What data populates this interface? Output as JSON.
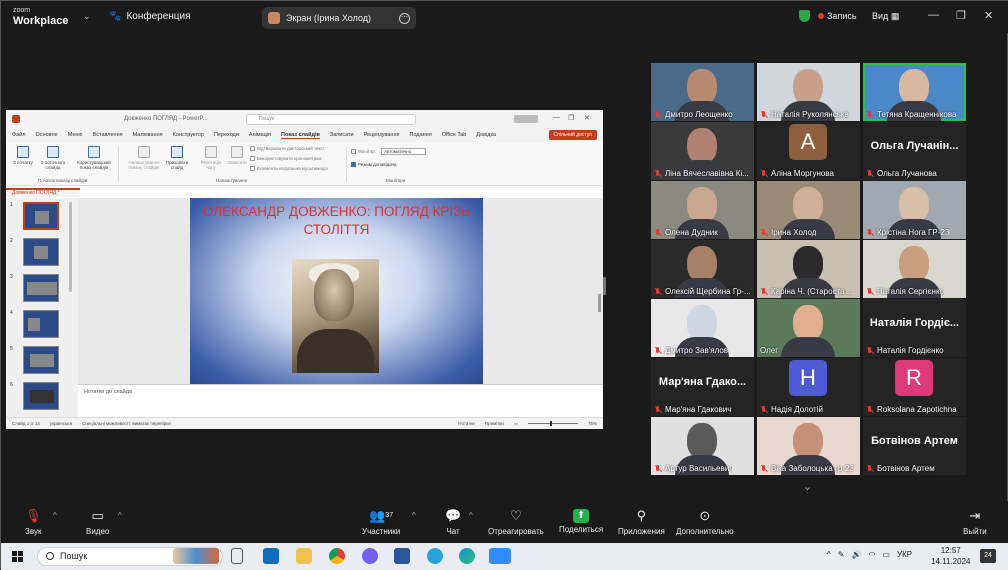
{
  "titlebar": {
    "app_top": "zoom",
    "app_bottom": "Workplace",
    "conference": "Конференция",
    "screen_label": "Экран (Ірина Холод)",
    "recording": "Запись",
    "view": "Вид"
  },
  "powerpoint": {
    "doc_title": "Довженко ПОГЛЯД - PowerP...",
    "search_placeholder": "Пошук",
    "tabs": [
      "Файл",
      "Основне",
      "Меню",
      "Вставлення",
      "Малювання",
      "Конструктор",
      "Переходи",
      "Анімація",
      "Показ слайдів",
      "Записати",
      "Рецензування",
      "Подання",
      "Office Tab",
      "Довідка"
    ],
    "share_button": "Спільний доступ",
    "ribbon": {
      "from_start": "З початку",
      "from_current": "З поточного слайда",
      "custom_show": "Користувацький показ слайдів",
      "setup_show": "Налаштування показу слайдів",
      "hide_slide": "Приховати слайд",
      "rehearse": "Репетиція часу",
      "record": "Записати",
      "chk_narration": "Відтворювати дикторський текст",
      "chk_timings": "Використовувати хронометраж",
      "chk_controls": "Елементи керування мультимедіа",
      "monitor_label": "Монітор:",
      "monitor_value": "Автоматично",
      "presenter_view": "Режим доповідача",
      "group_start": "Початок показу слайдів",
      "group_setup": "Налаштування",
      "group_monitors": "Монітори"
    },
    "file_tab": "Довженко ПОГЛЯД *",
    "slide_numbers": [
      "1",
      "2",
      "3",
      "4",
      "5",
      "6"
    ],
    "slide_title": "ОЛЕКСАНДР ДОВЖЕНКО: ПОГЛЯД КРІЗЬ СТОЛІТТЯ",
    "notes": "Нотатки до слайда",
    "status": {
      "slide_count": "Слайд 1 із 14",
      "language": "українська",
      "accessibility": "Спеціальні можливості: вимагає перевірки",
      "notes_btn": "Нотатки",
      "comments_btn": "Примітки",
      "zoom": "75%"
    }
  },
  "participants": [
    {
      "name": "Дмитро Леощенко",
      "kind": "video"
    },
    {
      "name": "Наталія Руколянська",
      "kind": "video"
    },
    {
      "name": "Тетяна Кращеннікова",
      "kind": "video",
      "active": true
    },
    {
      "name": "Ліна Вячеславівна Кі...",
      "kind": "video"
    },
    {
      "name": "Аліна Моргунова",
      "kind": "letter",
      "letter": "А",
      "color": "#8c5e3c"
    },
    {
      "name": "Ольга Лучанова",
      "kind": "text",
      "big": "Ольга Лучанін..."
    },
    {
      "name": "Олена Дудник",
      "kind": "video"
    },
    {
      "name": "Ірина Холод",
      "kind": "video"
    },
    {
      "name": "Крістіна Нога ГР-23",
      "kind": "video"
    },
    {
      "name": "Олексій Щербина Гр-...",
      "kind": "video"
    },
    {
      "name": "Каріна Ч. (Староста ...",
      "kind": "video"
    },
    {
      "name": "Наталія Сергієнко",
      "kind": "video"
    },
    {
      "name": "Дмитро Зав'ялов",
      "kind": "video"
    },
    {
      "name": "Олег",
      "kind": "video"
    },
    {
      "name": "Наталія Гордієнко",
      "kind": "text",
      "big": "Наталія Гордіє..."
    },
    {
      "name": "Мар'яна Гдакович",
      "kind": "text",
      "big": "Мар'яна Гдако..."
    },
    {
      "name": "Надія Долотій",
      "kind": "letter",
      "letter": "Н",
      "color": "#4d5bd4"
    },
    {
      "name": "Roksolana Zapotichna",
      "kind": "letter",
      "letter": "R",
      "color": "#e0397a"
    },
    {
      "name": "Артур Васильевич",
      "kind": "video"
    },
    {
      "name": "Віка Заболоцька гр-23",
      "kind": "video"
    },
    {
      "name": "Ботвінов Артем",
      "kind": "text",
      "big": "Ботвінов Артем"
    }
  ],
  "toolbar": {
    "mute": "Звук",
    "video": "Видео",
    "participants": "Участники",
    "participant_count": "37",
    "chat": "Чат",
    "react": "Отреагировать",
    "share": "Поделиться",
    "apps": "Приложения",
    "more": "Дополнительно",
    "leave": "Выйти"
  },
  "taskbar": {
    "search": "Пошук",
    "lang": "УКР",
    "time": "12:57",
    "date": "14.11.2024",
    "notifications": "24"
  },
  "colors": {
    "accent_green": "#27c24c",
    "powerpoint_red": "#c43e1c",
    "slide_title_red": "#e0302b",
    "muted_red": "#e53935"
  }
}
